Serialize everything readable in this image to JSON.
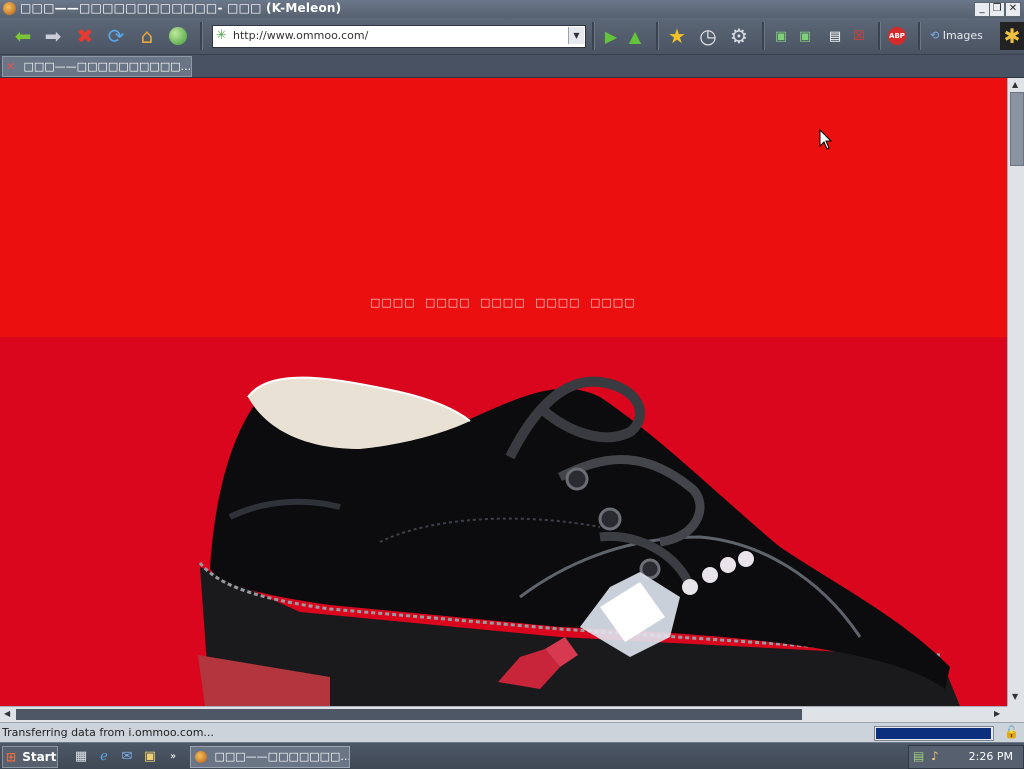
{
  "window": {
    "title": "□□□——□□□□□□□□□□□□- □□□ (K-Meleon)"
  },
  "toolbar": {
    "url": "http://www.ommoo.com/",
    "images_label": "Images"
  },
  "tabs": [
    {
      "label": "□□□——□□□□□□□□□□..."
    }
  ],
  "page": {
    "nav_links": [
      "□□□□",
      "□□□□",
      "□□□□",
      "□□□□",
      "□□□□"
    ]
  },
  "status": {
    "text": "Transferring data from i.ommoo.com...",
    "progress_fraction": 0.99
  },
  "taskbar": {
    "start_label": "Start",
    "task_label": "□□□——□□□□□□□...",
    "clock": "2:26 PM"
  },
  "colors": {
    "banner_top": "#ec0f10",
    "banner_bottom": "#d9061d"
  }
}
